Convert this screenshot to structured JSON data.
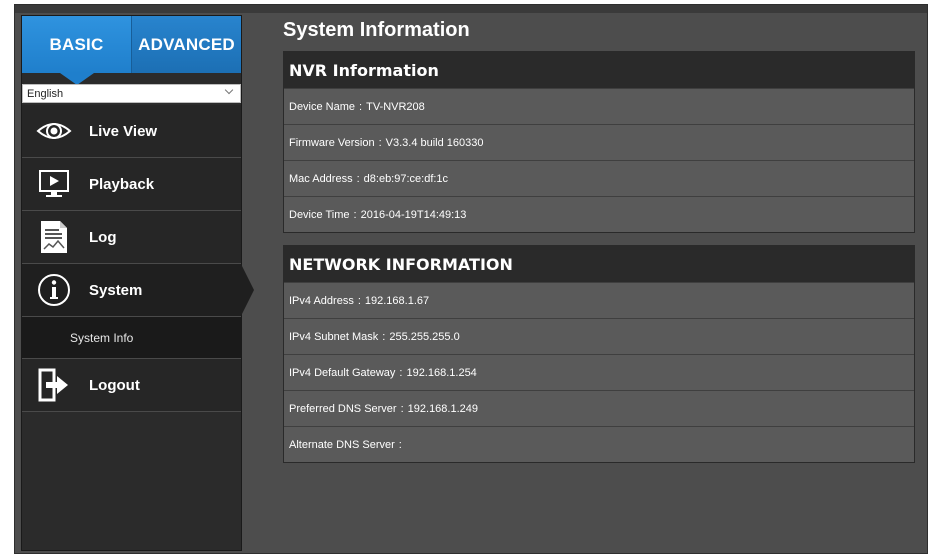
{
  "tabs": {
    "basic": "BASIC",
    "advanced": "ADVANCED"
  },
  "language": {
    "selected": "English"
  },
  "nav": {
    "live_view": "Live View",
    "playback": "Playback",
    "log": "Log",
    "system": "System",
    "system_info": "System Info",
    "logout": "Logout"
  },
  "page": {
    "title": "System Information"
  },
  "nvr_section": {
    "title": "NVR Information",
    "rows": [
      {
        "label": "Device Name",
        "value": "TV-NVR208"
      },
      {
        "label": "Firmware Version",
        "value": "V3.3.4 build 160330"
      },
      {
        "label": "Mac Address",
        "value": "d8:eb:97:ce:df:1c"
      },
      {
        "label": "Device Time",
        "value": "2016-04-19T14:49:13"
      }
    ]
  },
  "network_section": {
    "title": "NETWORK INFORMATION",
    "rows": [
      {
        "label": "IPv4 Address",
        "value": "192.168.1.67"
      },
      {
        "label": "IPv4 Subnet Mask",
        "value": "255.255.255.0"
      },
      {
        "label": "IPv4 Default Gateway",
        "value": "192.168.1.254"
      },
      {
        "label": "Preferred DNS Server",
        "value": "192.168.1.249"
      },
      {
        "label": "Alternate DNS Server",
        "value": ""
      }
    ]
  },
  "colors": {
    "accent": "#2f93df",
    "panel": "#4d4d4d",
    "row": "#5a5a5a",
    "header": "#2a2a2a"
  }
}
